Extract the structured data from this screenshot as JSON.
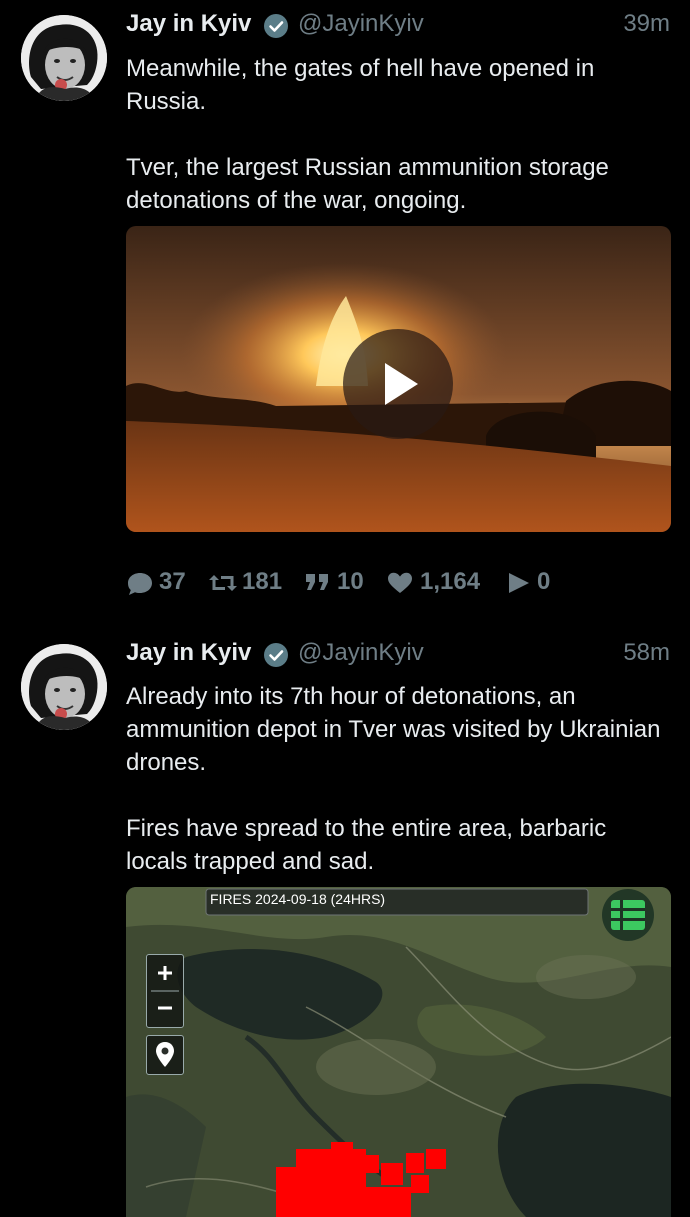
{
  "tweets": [
    {
      "author": "Jay in Kyiv",
      "handle": "@JayinKyiv",
      "time": "39m",
      "paragraphs": [
        "Meanwhile, the gates of hell have opened in Russia.",
        "Tver, the largest Russian ammunition storage detonations of the war, ongoing."
      ],
      "stats": {
        "replies": "37",
        "retweets": "181",
        "quotes": "10",
        "likes": "1,164",
        "views": "0"
      }
    },
    {
      "author": "Jay in Kyiv",
      "handle": "@JayinKyiv",
      "time": "58m",
      "paragraphs": [
        "Already into its 7th hour of detonations, an ammunition depot in Tver was visited by Ukrainian drones.",
        "Fires have spread to the entire area, barbaric locals trapped and sad."
      ],
      "map_header": "FIRES 2024-09-18 (24HRS)"
    }
  ],
  "icons": [
    "verified-badge-icon",
    "reply-icon",
    "retweet-icon",
    "quote-icon",
    "like-icon",
    "views-icon",
    "play-icon",
    "zoom-in-icon",
    "zoom-out-icon",
    "location-icon",
    "layers-icon"
  ],
  "colors": {
    "background": "#000000",
    "muted": "#6f7e86",
    "verified": "#5b7d88",
    "fire": "#ff0000",
    "layers": "#3cc860"
  }
}
